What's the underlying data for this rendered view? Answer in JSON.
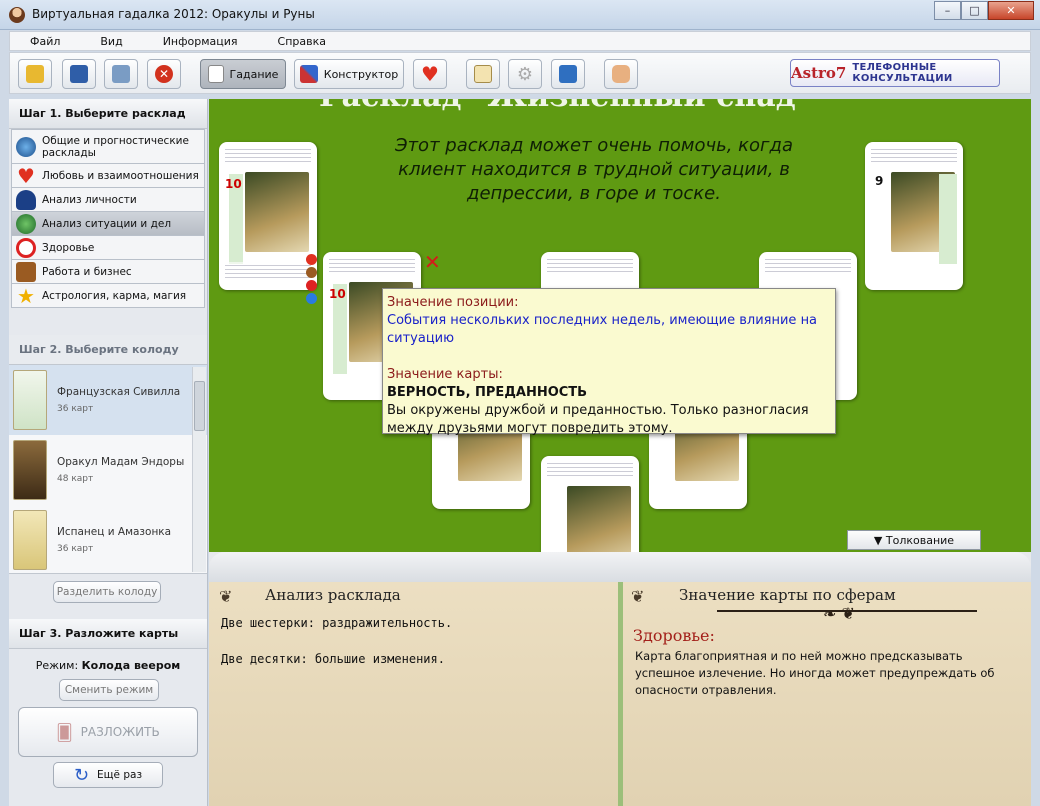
{
  "window": {
    "title": "Виртуальная гадалка 2012: Оракулы и Руны",
    "controls": [
      "–",
      "□",
      "✕"
    ]
  },
  "menu": [
    "Файл",
    "Вид",
    "Информация",
    "Справка"
  ],
  "toolbar": {
    "divination": "Гадание",
    "constructor": "Конструктор",
    "astro_brand": "Astro7",
    "astro_tagline": "ТЕЛЕФОННЫЕ КОНСУЛЬТАЦИИ"
  },
  "sidebar": {
    "step1": "Шаг 1. Выберите расклад",
    "layouts": [
      {
        "label": "Общие и прогностические расклады",
        "icon": "globe-icon"
      },
      {
        "label": "Любовь и взаимоотношения",
        "icon": "heart-icon"
      },
      {
        "label": "Анализ личности",
        "icon": "person-icon"
      },
      {
        "label": "Анализ ситуации и дел",
        "icon": "earth-icon"
      },
      {
        "label": "Здоровье",
        "icon": "medical-icon"
      },
      {
        "label": "Работа и бизнес",
        "icon": "briefcase-icon"
      },
      {
        "label": "Астрология, карма, магия",
        "icon": "star-icon"
      }
    ],
    "step2": "Шаг 2. Выберите колоду",
    "decks": [
      {
        "name": "Французская Сивилла",
        "count": "36 карт"
      },
      {
        "name": "Оракул Мадам Эндоры",
        "count": "48 карт"
      },
      {
        "name": "Испанец и Амазонка",
        "count": "36 карт"
      }
    ],
    "split_button": "Разделить колоду",
    "step3": "Шаг 3. Разложите карты",
    "mode_label": "Режим:",
    "mode_value": "Колода веером",
    "change_mode_button": "Сменить режим",
    "deal_button": "РАЗЛОЖИТЬ",
    "again_button": "Ещё раз"
  },
  "main": {
    "heading": "Расклад \"Жизненный спад\"",
    "description": "Этот расклад может очень помочь, когда клиент находится в трудной ситуации, в депрессии, в горе и тоске.",
    "tooltip": {
      "position_label": "Значение позиции:",
      "position_text": "События нескольких последних недель, имеющие влияние на ситуацию",
      "card_label": "Значение карты:",
      "card_title": "ВЕРНОСТЬ, ПРЕДАННОСТЬ",
      "card_text": "Вы окружены дружбой и преданностью. Только разногласия между друзьями могут повредить этому."
    },
    "interpretation_button": "▼ Толкование"
  },
  "analysis": {
    "title": "Анализ расклада",
    "lines": [
      "Две шестерки: раздражительность.",
      "Две десятки: большие изменения."
    ]
  },
  "spheres": {
    "title": "Значение карты по сферам",
    "sphere": "Здоровье:",
    "text": "Карта благоприятная и по ней можно предсказывать успешное излечение. Но иногда может предупреждать об опасности отравления."
  }
}
